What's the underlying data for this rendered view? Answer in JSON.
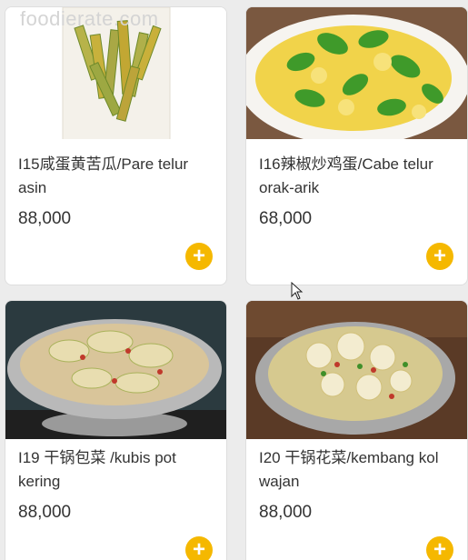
{
  "watermark": "foodierate.com",
  "items": [
    {
      "name": "I15咸蛋黄苦瓜/Pare telur asin",
      "price": "88,000",
      "image": "bitter-gourd-salted-egg-photo"
    },
    {
      "name": "I16辣椒炒鸡蛋/Cabe telur orak-arik",
      "price": "68,000",
      "image": "chili-scrambled-egg-photo"
    },
    {
      "name": "I19 干锅包菜 /kubis pot kering",
      "price": "88,000",
      "image": "dry-pot-cabbage-photo"
    },
    {
      "name": "I20 干锅花菜/kembang kol wajan",
      "price": "88,000",
      "image": "dry-pot-cauliflower-photo"
    }
  ],
  "add_icon": "plus-icon",
  "colors": {
    "accent": "#f5b800",
    "card": "#ffffff",
    "background": "#ececec"
  }
}
